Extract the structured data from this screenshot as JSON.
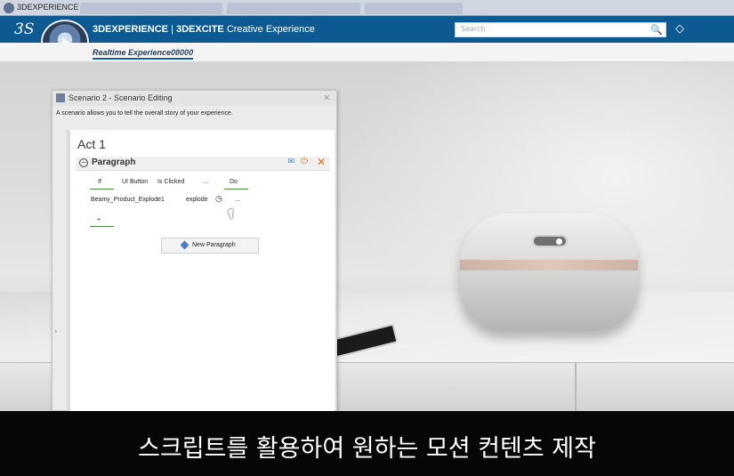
{
  "browser": {
    "title": "3DEXPERIENCE"
  },
  "header": {
    "ds_logo": "3S",
    "brand_part1": "3DEXPERIENCE",
    "brand_sep": " | ",
    "brand_part2": "3DEXCITE",
    "brand_part3": " Creative Experience",
    "search_placeholder": "Search"
  },
  "docbar": {
    "tab_label": "Realtime Experience00000",
    "add_label": "+"
  },
  "scenario_panel": {
    "title": "Scenario 2 - Scenario Editing",
    "close_label": "×",
    "description": "A scenario allows you to tell the overall story of your experience.",
    "act_label": "Act 1",
    "paragraph_label": "Paragraph",
    "rule": {
      "if_label": "If",
      "object": "UI Button",
      "condition": "Is Clicked",
      "ellipsis1": "...",
      "do_label": "Do",
      "action_object": "Beamy_Product_Explode1",
      "action": "explode",
      "ellipsis2": "...",
      "add_label": "+"
    },
    "new_paragraph_label": "New Paragraph"
  },
  "caption": {
    "text": "스크립트를 활용하여 원하는 모션 컨텐츠 제작"
  },
  "colors": {
    "header_blue": "#0d5a93",
    "accent_orange": "#e06b1a",
    "underline_green": "#4a8f3c"
  }
}
